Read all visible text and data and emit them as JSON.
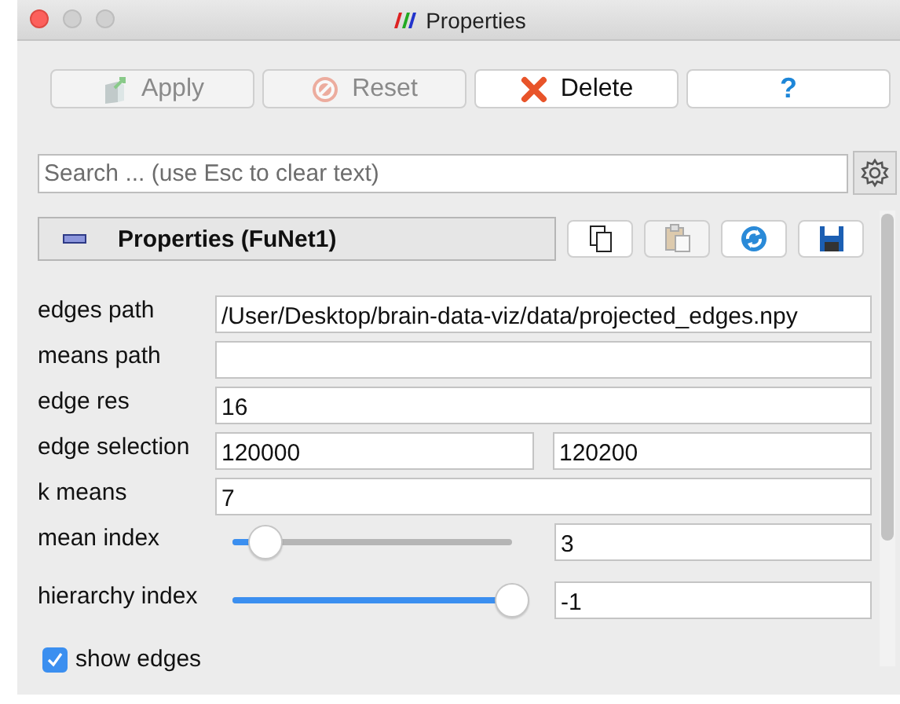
{
  "window": {
    "title": "Properties"
  },
  "toolbar": [
    {
      "kind": "apply",
      "label": "Apply",
      "disabled": true
    },
    {
      "kind": "reset",
      "label": "Reset",
      "disabled": true
    },
    {
      "kind": "delete",
      "label": "Delete",
      "disabled": false
    },
    {
      "kind": "help",
      "label": "?",
      "disabled": false
    }
  ],
  "search": {
    "placeholder": "Search ... (use Esc to clear text)"
  },
  "section": {
    "title": "Properties (FuNet1)",
    "actions": [
      {
        "kind": "copy",
        "disabled": false
      },
      {
        "kind": "paste",
        "disabled": true
      },
      {
        "kind": "refresh",
        "disabled": false
      },
      {
        "kind": "save",
        "disabled": false
      }
    ]
  },
  "properties": [
    {
      "kind": "text",
      "label": "edges path",
      "value": "/User/Desktop/brain-data-viz/data/projected_edges.npy"
    },
    {
      "kind": "text",
      "label": "means path"
    },
    {
      "kind": "text",
      "label": "edge res",
      "value": "16"
    },
    {
      "kind": "pair",
      "label": "edge selection",
      "values": [
        "120000",
        "120200"
      ]
    },
    {
      "kind": "text",
      "label": "k means",
      "value": "7"
    },
    {
      "kind": "slider",
      "label": "mean index",
      "level": 0.12,
      "value": "3"
    },
    {
      "kind": "slider",
      "label": "hierarchy index",
      "level": 1,
      "value": "-1"
    }
  ],
  "checkbox": {
    "label": "show edges",
    "checked": true
  }
}
